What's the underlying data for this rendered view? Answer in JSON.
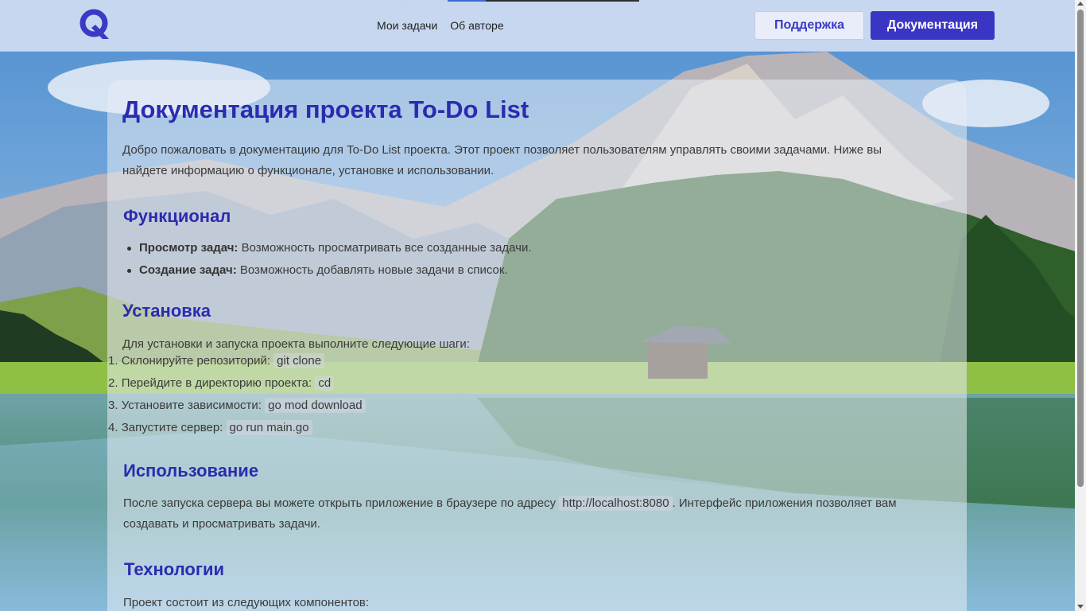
{
  "header": {
    "logo_icon": "q-logo-icon",
    "nav": [
      {
        "label": "Мои задачи"
      },
      {
        "label": "Об авторе"
      }
    ],
    "support_label": "Поддержка",
    "docs_label": "Документация"
  },
  "doc": {
    "title": "Документация проекта To-Do List",
    "intro_line1": "Добро пожаловать в документацию для To-Do List проекта. Этот проект позволяет пользователям управлять своими задачами. Ниже вы",
    "intro_line2": "найдете информацию о функционале, установке и использовании.",
    "features": {
      "heading": "Функционал",
      "items": [
        {
          "bold": "Просмотр задач:",
          "text": " Возможность просматривать все созданные задачи."
        },
        {
          "bold": "Создание задач:",
          "text": " Возможность добавлять новые задачи в список."
        }
      ]
    },
    "install": {
      "heading": "Установка",
      "intro": "Для установки и запуска проекта выполните следующие шаги:",
      "steps": [
        {
          "num": "1.",
          "text": "Склонируйте репозиторий: ",
          "code": "git clone"
        },
        {
          "num": "2.",
          "text": "Перейдите в директорию проекта: ",
          "code": "cd"
        },
        {
          "num": "3.",
          "text": "Установите зависимости: ",
          "code": "go mod download"
        },
        {
          "num": "4.",
          "text": "Запустите сервер: ",
          "code": "go run main.go"
        }
      ]
    },
    "usage": {
      "heading": "Использование",
      "line1_before": "После запуска сервера вы можете открыть приложение в браузере по адресу ",
      "line1_code": "http://localhost:8080",
      "line1_after": ". Интерфейс приложения позволяет вам",
      "line2": "создавать и просматривать задачи."
    },
    "tech": {
      "heading": "Технологии",
      "intro": "Проект состоит из следующих компонентов:"
    }
  },
  "colors": {
    "accent": "#3b35c4",
    "heading": "#2b2bb0"
  }
}
